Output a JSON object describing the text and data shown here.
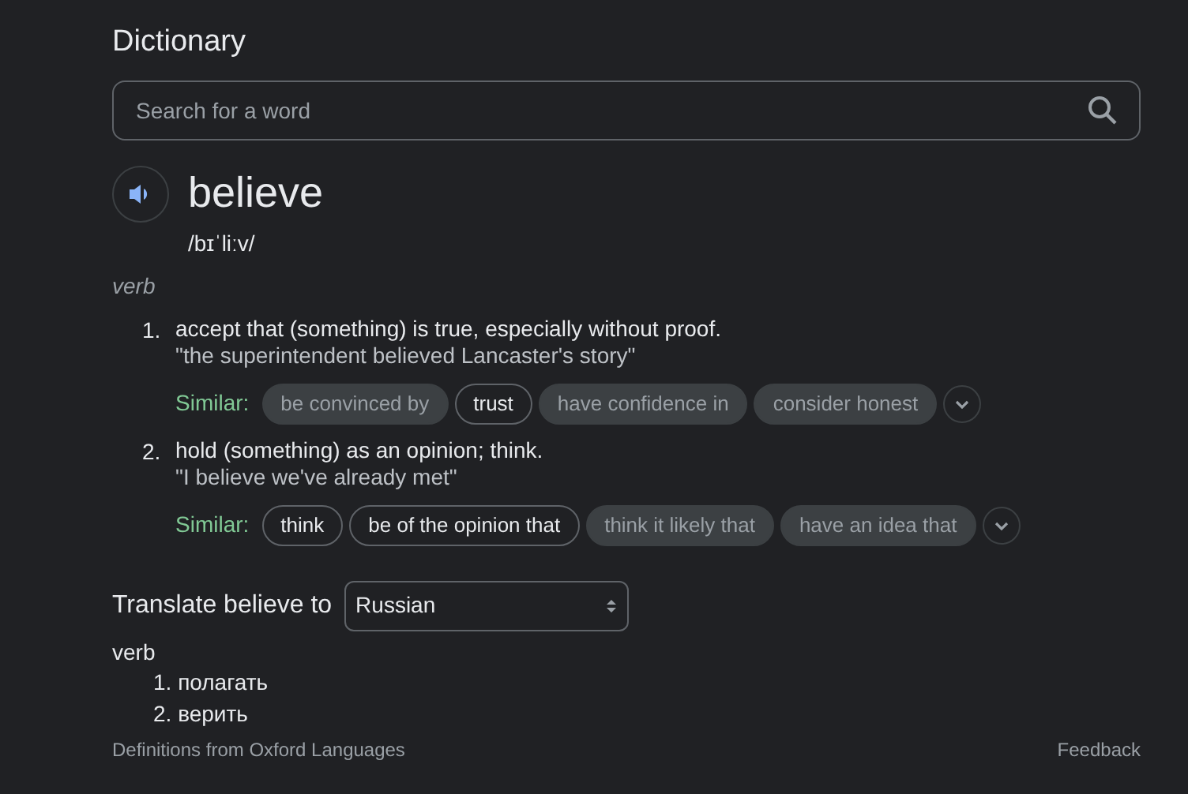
{
  "title": "Dictionary",
  "search": {
    "placeholder": "Search for a word"
  },
  "entry": {
    "word": "believe",
    "pronunciation": "/bɪˈliːv/",
    "part_of_speech": "verb",
    "senses": [
      {
        "number": "1.",
        "definition": "accept that (something) is true, especially without proof.",
        "example": "\"the superintendent believed Lancaster's story\"",
        "similar_label": "Similar:",
        "similar": [
          {
            "text": "be convinced by",
            "kind": "filled"
          },
          {
            "text": "trust",
            "kind": "outline"
          },
          {
            "text": "have confidence in",
            "kind": "filled"
          },
          {
            "text": "consider honest",
            "kind": "filled"
          }
        ]
      },
      {
        "number": "2.",
        "definition": "hold (something) as an opinion; think.",
        "example": "\"I believe we've already met\"",
        "similar_label": "Similar:",
        "similar": [
          {
            "text": "think",
            "kind": "outline"
          },
          {
            "text": "be of the opinion that",
            "kind": "outline"
          },
          {
            "text": "think it likely that",
            "kind": "filled"
          },
          {
            "text": "have an idea that",
            "kind": "filled"
          }
        ]
      }
    ]
  },
  "translate": {
    "label": "Translate believe to",
    "language": "Russian",
    "part_of_speech": "verb",
    "items": [
      {
        "number": "1.",
        "text": "полагать"
      },
      {
        "number": "2.",
        "text": "верить"
      }
    ]
  },
  "footer": {
    "source": "Definitions from Oxford Languages",
    "feedback": "Feedback"
  }
}
